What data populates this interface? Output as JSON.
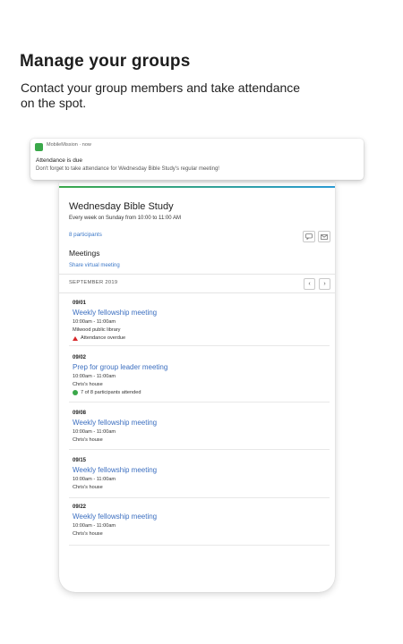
{
  "header": {
    "title": "Manage your groups",
    "subtitle": "Contact your group members and take attendance on the spot."
  },
  "notification": {
    "app_name": "MobileMission",
    "separator": "·",
    "time": "now",
    "title": "Attendance is due",
    "body": "Don't forget to take attendance for Wednesday Bible Study's regular meeting!",
    "icon": "app-icon"
  },
  "group": {
    "title": "Wednesday Bible Study",
    "schedule": "Every week on Sunday from 10:00 to 11:00 AM",
    "participants": "8 participants",
    "actions": {
      "chat_icon": "chat-icon",
      "mail_icon": "mail-icon"
    }
  },
  "meetings": {
    "heading": "Meetings",
    "virtual_link": "Share virtual meeting",
    "month": "SEPTEMBER 2019",
    "prev_symbol": "‹",
    "next_symbol": "›",
    "items": [
      {
        "date": "09/01",
        "title": "Weekly fellowship meeting",
        "time": "10:00am - 11:00am",
        "location": "Milwood public library",
        "status": "Attendance overdue",
        "status_type": "warning"
      },
      {
        "date": "09/02",
        "title": "Prep for group leader meeting",
        "time": "10:00am - 11:00am",
        "location": "Chris's house",
        "status": "7 of 8 participants attended",
        "status_type": "ok"
      },
      {
        "date": "09/08",
        "title": "Weekly fellowship meeting",
        "time": "10:00am - 11:00am",
        "location": "Chris's house"
      },
      {
        "date": "09/15",
        "title": "Weekly fellowship meeting",
        "time": "10:00am - 11:00am",
        "location": "Chris's house"
      },
      {
        "date": "09/22",
        "title": "Weekly fellowship meeting",
        "time": "10:00am - 11:00am",
        "location": "Chris's house"
      }
    ]
  },
  "colors": {
    "accent_green": "#3aa84a",
    "accent_blue": "#2b9bd4",
    "link_blue": "#3c6fc0",
    "warning_red": "#d8282a"
  }
}
